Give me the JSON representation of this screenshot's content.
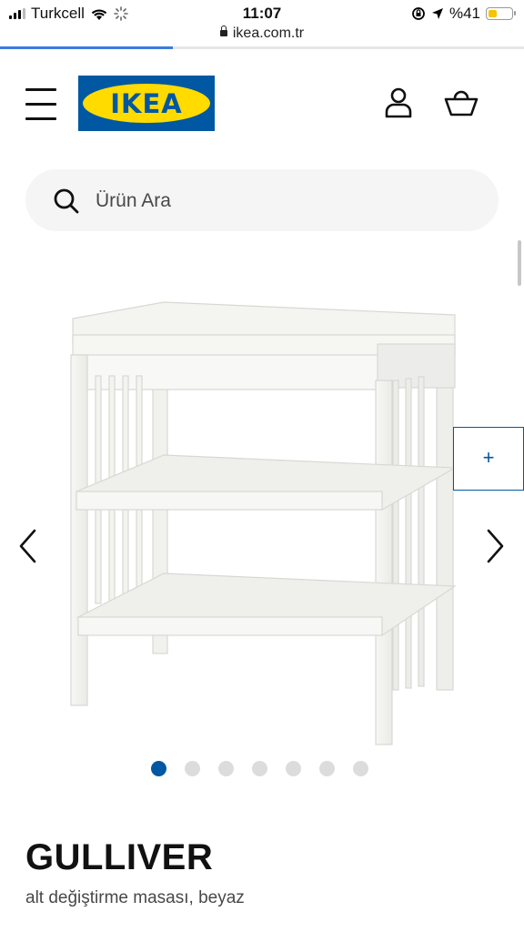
{
  "status": {
    "carrier": "Turkcell",
    "time": "11:07",
    "battery": "%41",
    "battery_level": 0.41
  },
  "browser": {
    "url": "ikea.com.tr",
    "load_progress": 0.33
  },
  "header": {
    "logo_text": "IKEA",
    "logo_reg": "®",
    "menu_icon": "hamburger-icon",
    "account_icon": "person-icon",
    "cart_icon": "basket-icon"
  },
  "search": {
    "placeholder": "Ürün Ara",
    "icon": "search-icon"
  },
  "gallery": {
    "total_images": 7,
    "active_index": 0,
    "hotspot_label": "+"
  },
  "product": {
    "name": "GULLIVER",
    "description": "alt değiştirme masası, beyaz"
  },
  "colors": {
    "brand_blue": "#0058a3",
    "brand_yellow": "#ffdb00",
    "search_bg": "#f5f5f5"
  }
}
